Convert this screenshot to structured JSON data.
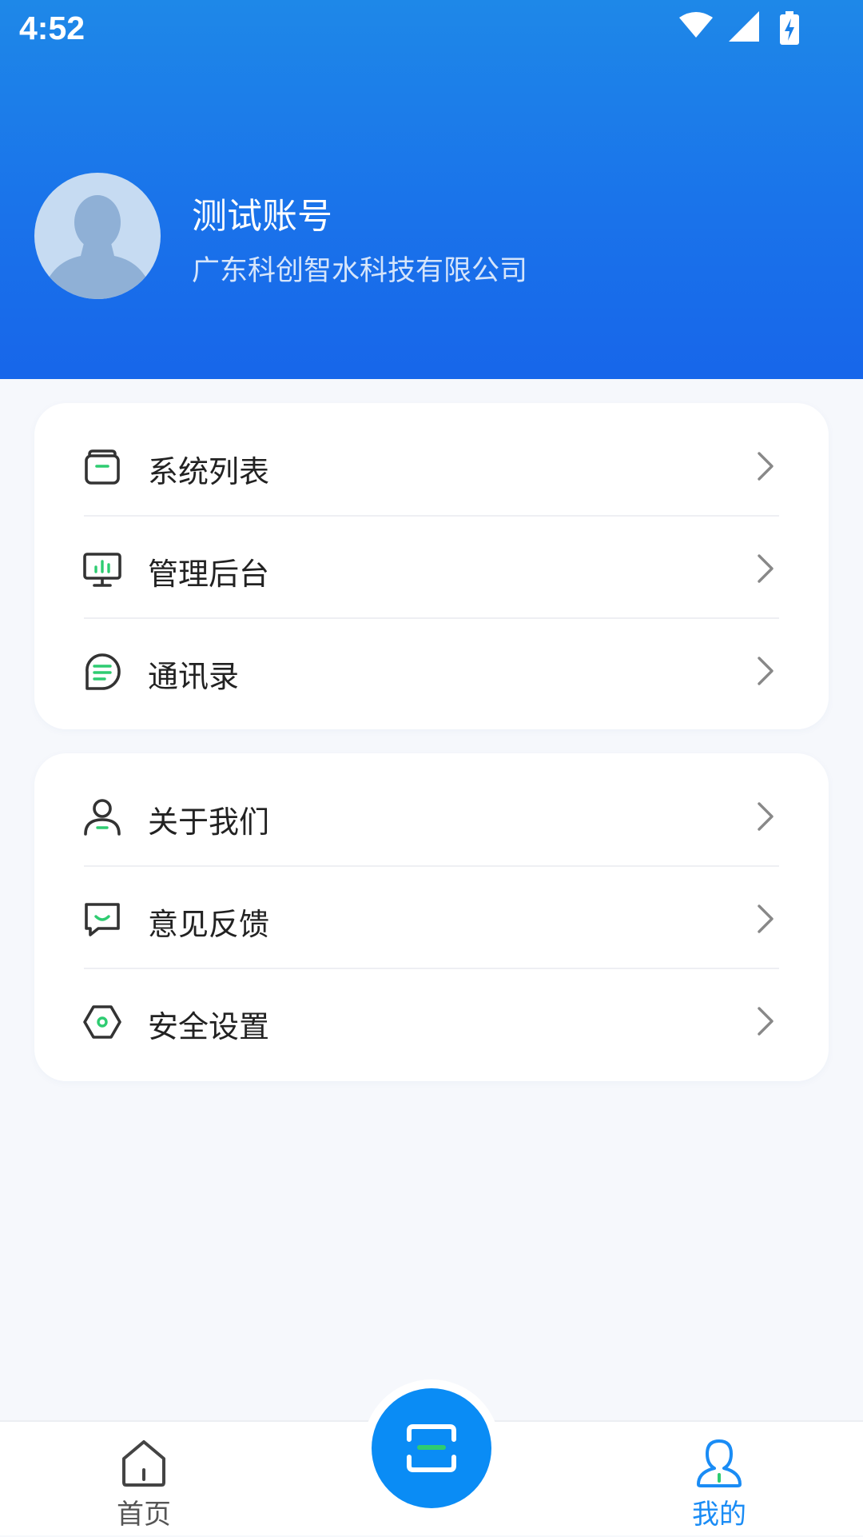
{
  "status_bar": {
    "time": "4:52",
    "icons": [
      "wifi-icon",
      "signal-icon",
      "battery-charging-icon"
    ]
  },
  "profile": {
    "name": "测试账号",
    "company": "广东科创智水科技有限公司"
  },
  "menu_group_1": [
    {
      "label": "系统列表",
      "icon": "box-icon"
    },
    {
      "label": "管理后台",
      "icon": "monitor-chart-icon"
    },
    {
      "label": "通讯录",
      "icon": "chat-list-icon"
    }
  ],
  "menu_group_2": [
    {
      "label": "关于我们",
      "icon": "person-icon"
    },
    {
      "label": "意见反馈",
      "icon": "feedback-smile-icon"
    },
    {
      "label": "安全设置",
      "icon": "hexagon-nut-icon"
    }
  ],
  "tabbar": {
    "home_label": "首页",
    "mine_label": "我的",
    "center_icon": "scan-icon"
  },
  "colors": {
    "header_top": "#1e88e8",
    "header_bottom": "#1766ea",
    "accent_green": "#2ecc71",
    "active_tab": "#1a8cf5",
    "scan_button": "#0a8cf5"
  }
}
